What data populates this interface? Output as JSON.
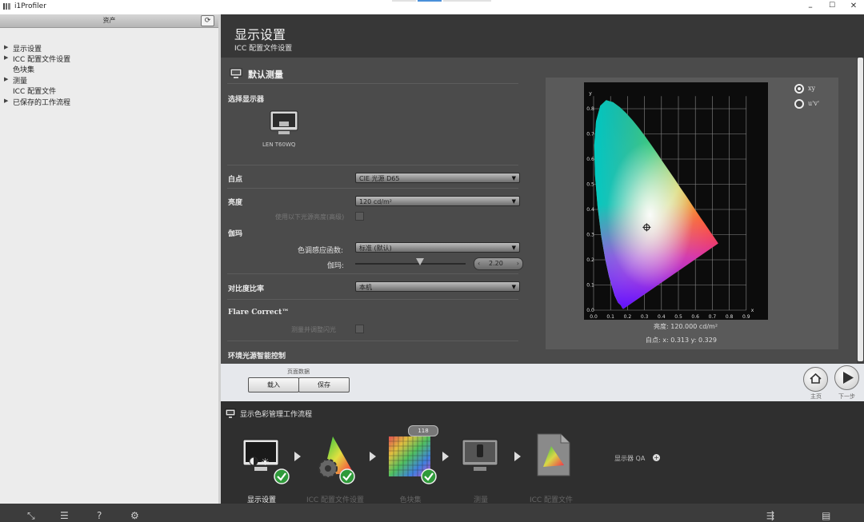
{
  "window": {
    "title": "i1Profiler",
    "minimize": "–",
    "maximize": "☐",
    "close": "✕"
  },
  "sidebar": {
    "header": "资产",
    "refresh_icon": "refresh-icon",
    "items": [
      {
        "label": "显示设置",
        "expandable": true
      },
      {
        "label": "ICC 配置文件设置",
        "expandable": true
      },
      {
        "label": "色块集",
        "expandable": false
      },
      {
        "label": "测量",
        "expandable": true
      },
      {
        "label": "ICC 配置文件",
        "expandable": false
      },
      {
        "label": "已保存的工作流程",
        "expandable": true
      }
    ]
  },
  "header": {
    "title": "显示设置",
    "subtitle": "ICC 配置文件设置"
  },
  "section": {
    "title": "默认测量",
    "select_display_label": "选择显示器",
    "display_name": "LEN T60WQ",
    "white_point": {
      "label": "白点",
      "value": "CIE 光源 D65"
    },
    "luminance": {
      "label": "亮度",
      "value": "120 cd/m²",
      "checkbox_label": "使用以下光源亮度(高级)"
    },
    "gamma": {
      "label": "伽玛",
      "tone_label": "色调感应函数:",
      "tone_value": "标准 (默认)",
      "gamma_label": "伽玛:",
      "gamma_value": "2.20",
      "slider_fraction": 0.59
    },
    "contrast": {
      "label": "对比度比率",
      "value": "本机"
    },
    "flare": {
      "label": "Flare Correct™",
      "checkbox_label": "测量并调整闪光"
    },
    "ambient": {
      "label": "环境光源智能控制"
    }
  },
  "chart": {
    "options": [
      {
        "label": "xy",
        "selected": true
      },
      {
        "label": "u'v'",
        "selected": false
      }
    ],
    "luminance_text": "亮度:  120.000 cd/m²",
    "whitepoint_text": "白点:  x: 0.313  y: 0.329",
    "xlabel": "x",
    "ylabel": "y",
    "xticks": [
      "0.0",
      "0.1",
      "0.2",
      "0.3",
      "0.4",
      "0.5",
      "0.6",
      "0.7",
      "0.8",
      "0.9"
    ],
    "yticks": [
      "0.0",
      "0.1",
      "0.2",
      "0.3",
      "0.4",
      "0.5",
      "0.6",
      "0.7",
      "0.8"
    ],
    "white_point": {
      "x": 0.313,
      "y": 0.329
    }
  },
  "bottombar": {
    "page_data_label": "页面数据",
    "load": "载入",
    "save": "保存",
    "home": "主页",
    "next": "下一步"
  },
  "workflow": {
    "title": "显示色彩管理工作流程",
    "steps": [
      {
        "label": "显示设置",
        "active": true,
        "done": true
      },
      {
        "label": "ICC 配置文件设置",
        "active": false,
        "done": true
      },
      {
        "label": "色块集",
        "active": false,
        "done": true,
        "badge": "118"
      },
      {
        "label": "测量",
        "active": false,
        "done": false
      },
      {
        "label": "ICC 配置文件",
        "active": false,
        "done": false
      }
    ],
    "qa_label": "显示器 QA"
  },
  "taskbar": {
    "icons": [
      "expand-icon",
      "list-icon",
      "help-icon",
      "gear-icon",
      "export-icon",
      "save-icon"
    ]
  }
}
